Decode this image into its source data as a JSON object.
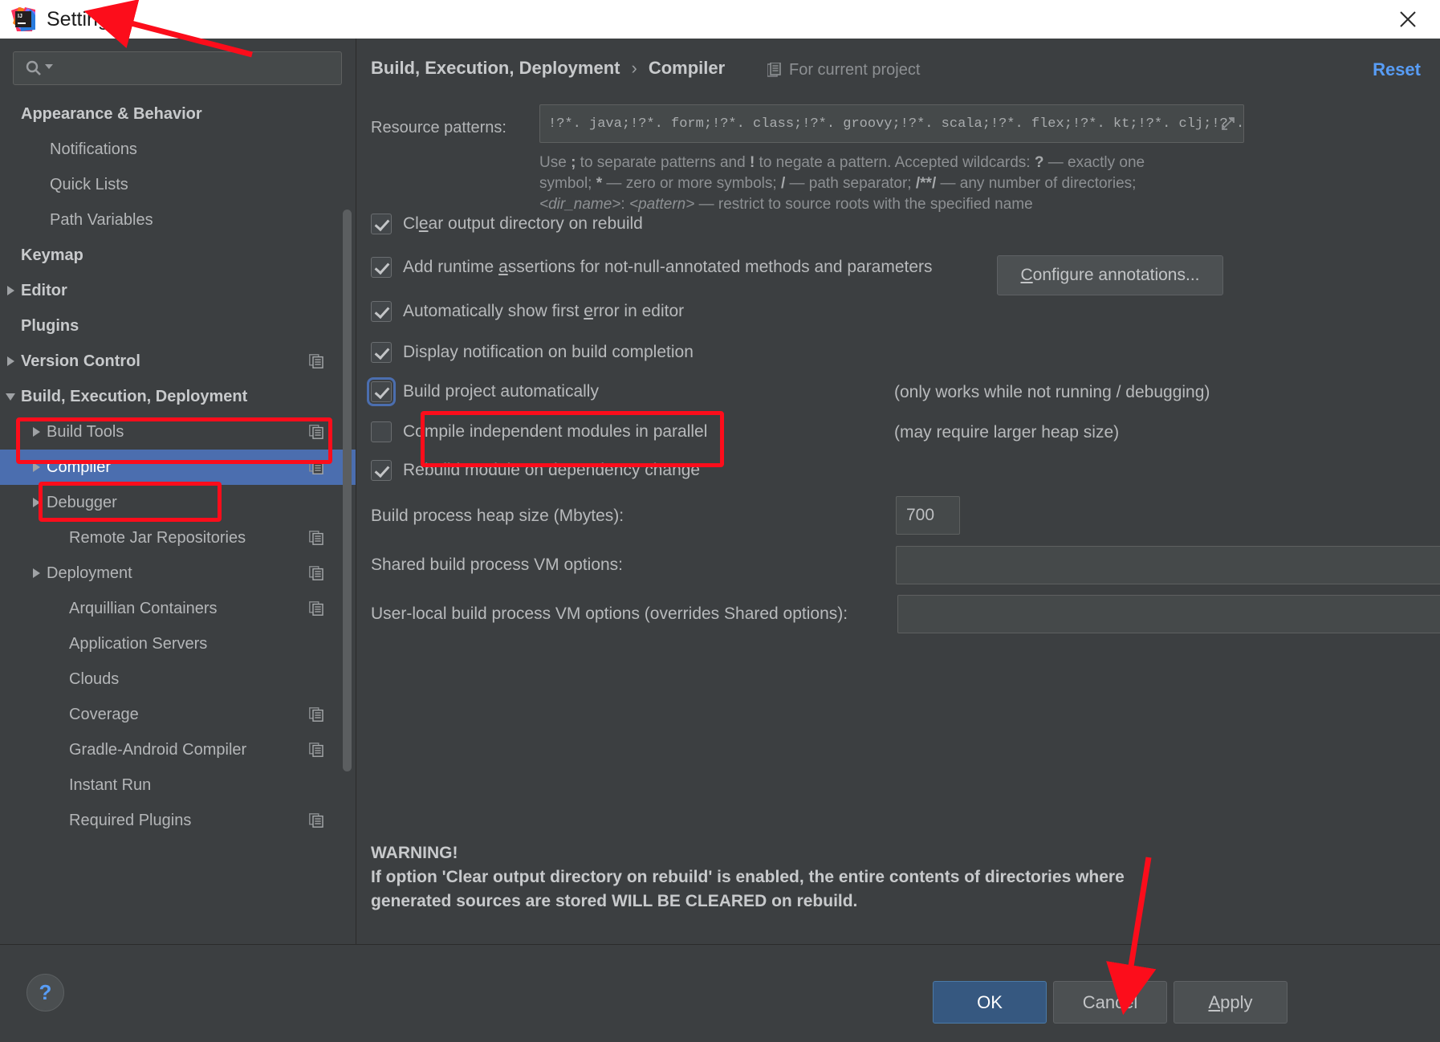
{
  "window": {
    "title": "Settings",
    "logo_icon": "intellij-idea-logo",
    "close_icon": "close-icon"
  },
  "search": {
    "placeholder": "",
    "value": "",
    "icon": "search-icon",
    "dropdown_icon": "chevron-down-icon"
  },
  "sidebar": {
    "items": [
      {
        "label": "Appearance & Behavior",
        "indent": 26,
        "bold": true,
        "arrow": "none",
        "selected": false,
        "copy_icon": false
      },
      {
        "label": "Notifications",
        "indent": 62,
        "bold": false,
        "arrow": "none",
        "selected": false,
        "copy_icon": false
      },
      {
        "label": "Quick Lists",
        "indent": 62,
        "bold": false,
        "arrow": "none",
        "selected": false,
        "copy_icon": false
      },
      {
        "label": "Path Variables",
        "indent": 62,
        "bold": false,
        "arrow": "none",
        "selected": false,
        "copy_icon": false
      },
      {
        "label": "Keymap",
        "indent": 26,
        "bold": true,
        "arrow": "none",
        "selected": false,
        "copy_icon": false
      },
      {
        "label": "Editor",
        "indent": 26,
        "bold": true,
        "arrow": "right",
        "selected": false,
        "copy_icon": false
      },
      {
        "label": "Plugins",
        "indent": 26,
        "bold": true,
        "arrow": "none",
        "selected": false,
        "copy_icon": false
      },
      {
        "label": "Version Control",
        "indent": 26,
        "bold": true,
        "arrow": "right",
        "selected": false,
        "copy_icon": true
      },
      {
        "label": "Build, Execution, Deployment",
        "indent": 26,
        "bold": true,
        "arrow": "down",
        "selected": false,
        "copy_icon": false
      },
      {
        "label": "Build Tools",
        "indent": 58,
        "bold": false,
        "arrow": "right",
        "selected": false,
        "copy_icon": true
      },
      {
        "label": "Compiler",
        "indent": 58,
        "bold": false,
        "arrow": "right",
        "selected": true,
        "copy_icon": true
      },
      {
        "label": "Debugger",
        "indent": 58,
        "bold": false,
        "arrow": "right",
        "selected": false,
        "copy_icon": false
      },
      {
        "label": "Remote Jar Repositories",
        "indent": 86,
        "bold": false,
        "arrow": "none",
        "selected": false,
        "copy_icon": true
      },
      {
        "label": "Deployment",
        "indent": 58,
        "bold": false,
        "arrow": "right",
        "selected": false,
        "copy_icon": true
      },
      {
        "label": "Arquillian Containers",
        "indent": 86,
        "bold": false,
        "arrow": "none",
        "selected": false,
        "copy_icon": true
      },
      {
        "label": "Application Servers",
        "indent": 86,
        "bold": false,
        "arrow": "none",
        "selected": false,
        "copy_icon": false
      },
      {
        "label": "Clouds",
        "indent": 86,
        "bold": false,
        "arrow": "none",
        "selected": false,
        "copy_icon": false
      },
      {
        "label": "Coverage",
        "indent": 86,
        "bold": false,
        "arrow": "none",
        "selected": false,
        "copy_icon": true
      },
      {
        "label": "Gradle-Android Compiler",
        "indent": 86,
        "bold": false,
        "arrow": "none",
        "selected": false,
        "copy_icon": true
      },
      {
        "label": "Instant Run",
        "indent": 86,
        "bold": false,
        "arrow": "none",
        "selected": false,
        "copy_icon": false
      },
      {
        "label": "Required Plugins",
        "indent": 86,
        "bold": false,
        "arrow": "none",
        "selected": false,
        "copy_icon": true
      }
    ]
  },
  "main": {
    "breadcrumb": {
      "root": "Build, Execution, Deployment",
      "separator": "›",
      "leaf": "Compiler"
    },
    "scope": {
      "label": "For current project",
      "icon": "project-scope-icon"
    },
    "reset_label": "Reset",
    "resource_patterns": {
      "label": "Resource patterns:",
      "value": "!?*. java;!?*. form;!?*. class;!?*. groovy;!?*. scala;!?*. flex;!?*. kt;!?*. clj;!?*. a,",
      "expand_icon": "expand-editor-icon"
    },
    "hint": {
      "line1_a": "Use ",
      "line1_semicolon": ";",
      "line1_b": " to separate patterns and ",
      "line1_bang": "!",
      "line1_c": " to negate a pattern. Accepted wildcards: ",
      "line1_q": "?",
      "line1_d": " — exactly one",
      "line2_a": "symbol; ",
      "line2_star": "*",
      "line2_b": " — zero or more symbols; ",
      "line2_slash": "/",
      "line2_c": " — path separator; ",
      "line2_dstar": "/**/",
      "line2_d": " — any number of directories;",
      "line3_dir": "<dir_name>",
      "line3_colon": ": ",
      "line3_pat": "<pattern>",
      "line3_rest": " — restrict to source roots with the specified name"
    },
    "checkboxes": [
      {
        "label_pre": "Cl",
        "label_mn": "e",
        "label_post": "ar output directory on rebuild",
        "checked": true,
        "focused": false,
        "note": ""
      },
      {
        "label_pre": "Add runtime ",
        "label_mn": "a",
        "label_post": "ssertions for not-null-annotated methods and parameters",
        "checked": true,
        "focused": false,
        "note": ""
      },
      {
        "label_pre": "Automatically show first ",
        "label_mn": "e",
        "label_post": "rror in editor",
        "checked": true,
        "focused": false,
        "note": ""
      },
      {
        "label_pre": "Display notification on build completion",
        "label_mn": "",
        "label_post": "",
        "checked": true,
        "focused": false,
        "note": ""
      },
      {
        "label_pre": "Build project automatically",
        "label_mn": "",
        "label_post": "",
        "checked": true,
        "focused": true,
        "note": "(only works while not running / debugging)"
      },
      {
        "label_pre": "Compile independent modules in parallel",
        "label_mn": "",
        "label_post": "",
        "checked": false,
        "focused": false,
        "note": "(may require larger heap size)"
      },
      {
        "label_pre": "Rebuild module on dependency change",
        "label_mn": "",
        "label_post": "",
        "checked": true,
        "focused": false,
        "note": ""
      }
    ],
    "configure_annotations": {
      "pre": "",
      "mn": "C",
      "post": "onfigure annotations..."
    },
    "fields": [
      {
        "label": "Build process heap size (Mbytes):",
        "value": "700"
      },
      {
        "label": "Shared build process VM options:",
        "value": ""
      },
      {
        "label": "User-local build process VM options (overrides Shared options):",
        "value": ""
      }
    ],
    "warning": {
      "title": "WARNING!",
      "line1": "If option 'Clear output directory on rebuild' is enabled, the entire contents of directories where",
      "line2": "generated sources are stored WILL BE CLEARED on rebuild."
    }
  },
  "footer": {
    "help_icon": "help-icon",
    "help_label": "?",
    "ok": "OK",
    "cancel": "Cancel",
    "apply_mn": "A",
    "apply_rest": "pply"
  },
  "annotations": {
    "color": "#fc0d1b",
    "boxes": [
      "build-execution-deployment-row",
      "compiler-row",
      "build-project-automatically-checkbox"
    ],
    "arrows": [
      "arrow-to-title",
      "arrow-to-ok-button"
    ]
  }
}
